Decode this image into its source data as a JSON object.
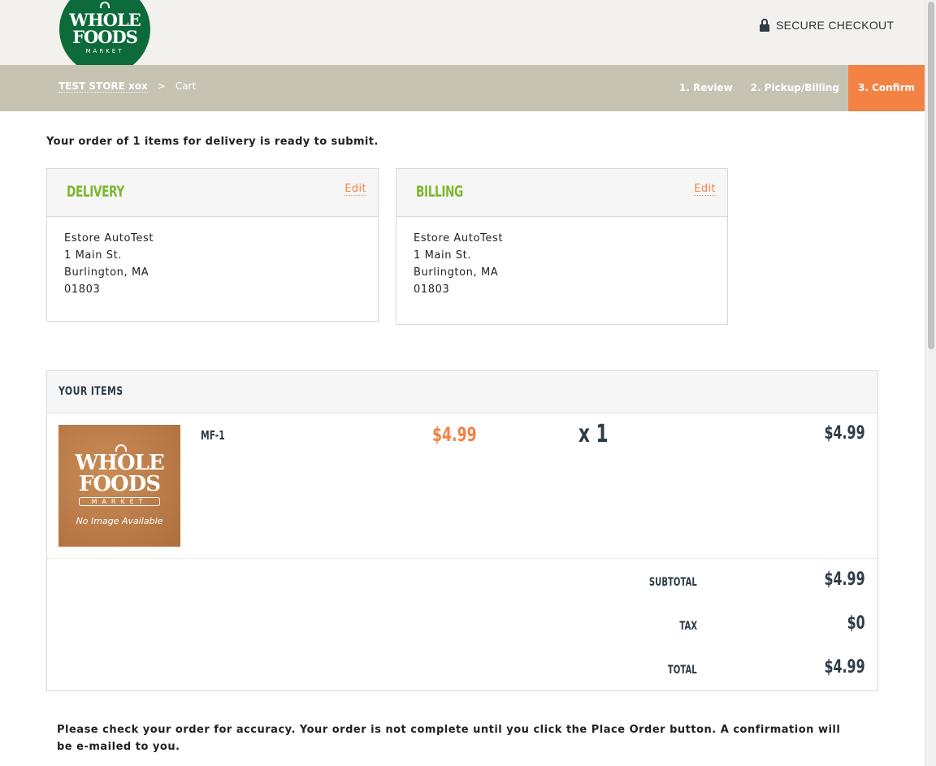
{
  "brand": {
    "line1": "WHOLE",
    "line2": "FOODS",
    "line3": "MARKET"
  },
  "header": {
    "secure_label": "SECURE CHECKOUT"
  },
  "breadcrumb": {
    "store": "TEST STORE xox",
    "separator": ">",
    "current": "Cart"
  },
  "steps": [
    {
      "label": "1. Review"
    },
    {
      "label": "2. Pickup/Billing"
    },
    {
      "label": "3. Confirm",
      "active": true
    }
  ],
  "order_message": "Your order of 1 items for delivery is ready to submit.",
  "delivery": {
    "title": "DELIVERY",
    "edit_label": "Edit",
    "lines": [
      "Estore AutoTest",
      "1 Main St.",
      "Burlington, MA",
      "01803"
    ]
  },
  "billing": {
    "title": "BILLING",
    "edit_label": "Edit",
    "lines": [
      "Estore AutoTest",
      "1 Main St.",
      "Burlington, MA",
      "01803"
    ]
  },
  "items_section": {
    "title": "YOUR ITEMS",
    "items": [
      {
        "name": "MF-1",
        "price": "$4.99",
        "quantity": "x 1",
        "total": "$4.99",
        "image_text": {
          "line1": "WHOLE",
          "line2": "FOODS",
          "line3": "MARKET",
          "caption": "No Image Available"
        }
      }
    ],
    "summary": {
      "subtotal_label": "SUBTOTAL",
      "subtotal_value": "$4.99",
      "tax_label": "TAX",
      "tax_value": "$0",
      "total_label": "TOTAL",
      "total_value": "$4.99"
    }
  },
  "notice": "Please check your order for accuracy. Your order is not complete until you click the Place Order button. A confirmation will be e-mailed to you.",
  "colors": {
    "accent": "#f28344",
    "green": "#7cb82f",
    "brand_green": "#0d6b3b",
    "navbar": "#c6c3b3",
    "dark": "#2f3b48"
  }
}
